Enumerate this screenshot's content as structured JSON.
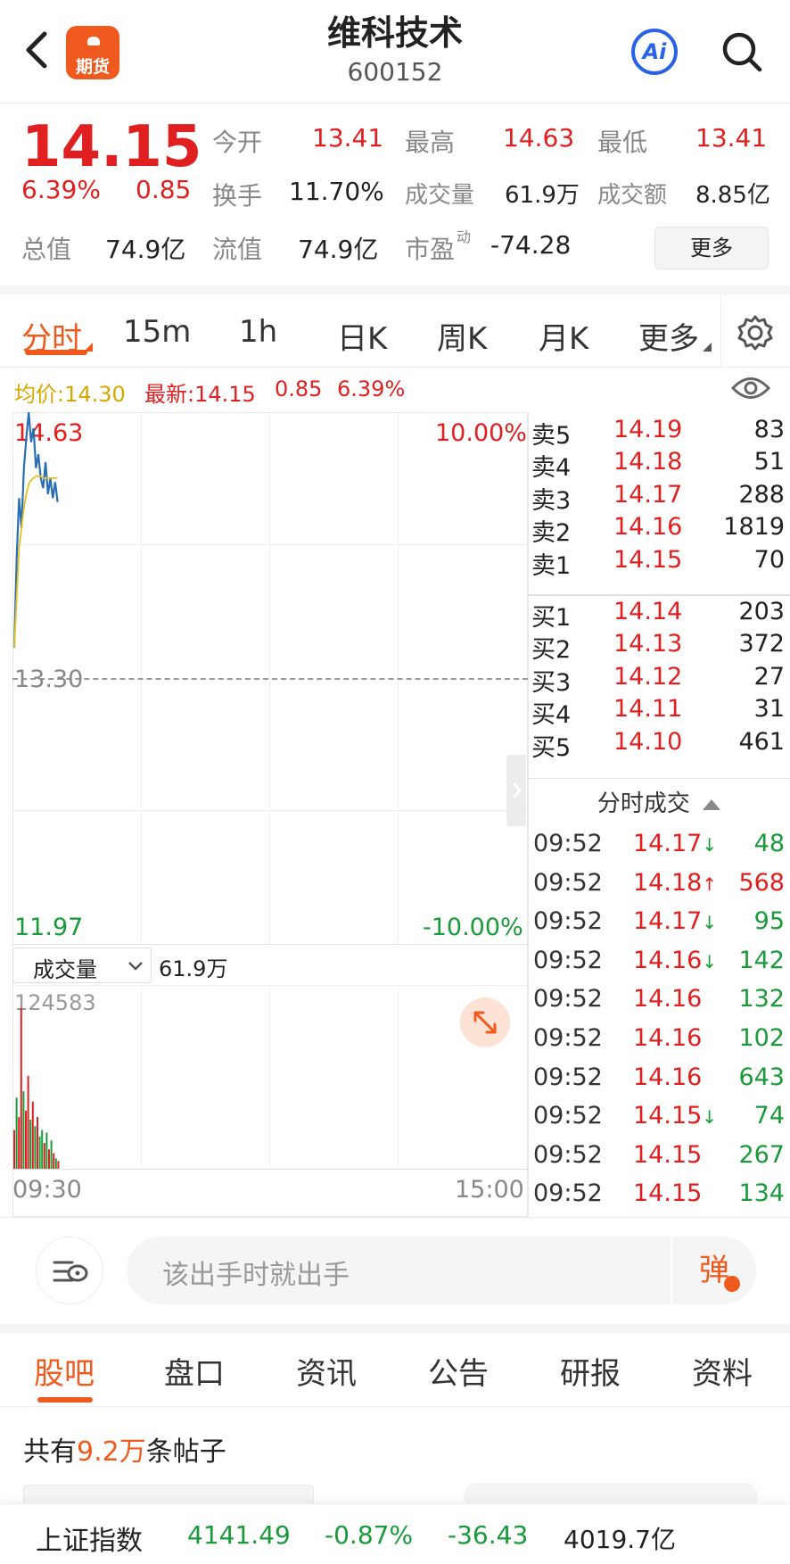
{
  "header": {
    "back_icon": "chevron-left-icon",
    "futures_badge": "期货",
    "title": "维科技术",
    "code": "600152",
    "ai_label": "Ai",
    "search_icon": "search-icon"
  },
  "quote": {
    "price": "14.15",
    "change_pct": "6.39%",
    "change": "0.85",
    "open_label": "今开",
    "open": "13.41",
    "high_label": "最高",
    "high": "14.63",
    "low_label": "最低",
    "low": "13.41",
    "turnover_label": "换手",
    "turnover": "11.70%",
    "volume_label": "成交量",
    "volume": "61.9万",
    "amount_label": "成交额",
    "amount": "8.85亿",
    "mktcap_label": "总值",
    "mktcap": "74.9亿",
    "float_label": "流值",
    "float": "74.9亿",
    "pe_label": "市盈",
    "pe_sup": "动",
    "pe": "-74.28",
    "more_button": "更多"
  },
  "period_tabs": [
    "分时",
    "15m",
    "1h",
    "日K",
    "周K",
    "月K",
    "更多"
  ],
  "chart_info": {
    "avg_label": "均价:14.30",
    "latest_label": "最新:14.15",
    "latest_change": "0.85",
    "latest_pct": "6.39%"
  },
  "chart_data": {
    "type": "line",
    "y_top_label": "14.63",
    "y_mid_label": "13.30",
    "y_bottom_label": "11.97",
    "pct_top_label": "10.00%",
    "pct_bottom_label": "-10.00%",
    "x_start": "09:30",
    "x_end": "15:00",
    "ylim": [
      11.97,
      14.63
    ],
    "series": [
      {
        "name": "price",
        "values": [
          13.45,
          13.9,
          14.2,
          14.05,
          14.35,
          14.5,
          14.63,
          14.48,
          14.55,
          14.35,
          14.42,
          14.3,
          14.25,
          14.38,
          14.22,
          14.3,
          14.2,
          14.28,
          14.18
        ]
      },
      {
        "name": "avg",
        "values": [
          13.45,
          13.7,
          13.95,
          14.05,
          14.15,
          14.22,
          14.27,
          14.29,
          14.3,
          14.31,
          14.31,
          14.31,
          14.3,
          14.3,
          14.3,
          14.3,
          14.3,
          14.3,
          14.3
        ]
      }
    ],
    "volume": {
      "max_label": "124583",
      "values": [
        30000,
        55000,
        40000,
        124583,
        60000,
        45000,
        72000,
        38000,
        52000,
        33000,
        40000,
        25000,
        30000,
        20000,
        28000,
        15000,
        22000,
        12000,
        8000,
        6000
      ],
      "up": [
        1,
        0,
        1,
        1,
        0,
        1,
        1,
        0,
        1,
        0,
        1,
        0,
        0,
        1,
        0,
        1,
        0,
        1,
        0,
        1
      ]
    },
    "volume_selector": "成交量",
    "volume_total": "61.9万"
  },
  "orderbook": {
    "asks": [
      {
        "label": "卖5",
        "price": "14.19",
        "vol": "83"
      },
      {
        "label": "卖4",
        "price": "14.18",
        "vol": "51"
      },
      {
        "label": "卖3",
        "price": "14.17",
        "vol": "288"
      },
      {
        "label": "卖2",
        "price": "14.16",
        "vol": "1819"
      },
      {
        "label": "卖1",
        "price": "14.15",
        "vol": "70"
      }
    ],
    "bids": [
      {
        "label": "买1",
        "price": "14.14",
        "vol": "203"
      },
      {
        "label": "买2",
        "price": "14.13",
        "vol": "372"
      },
      {
        "label": "买3",
        "price": "14.12",
        "vol": "27"
      },
      {
        "label": "买4",
        "price": "14.11",
        "vol": "31"
      },
      {
        "label": "买5",
        "price": "14.10",
        "vol": "461"
      }
    ]
  },
  "ticks_header": "分时成交",
  "ticks": [
    {
      "time": "09:52",
      "price": "14.17",
      "arrow": "↓",
      "vol": "48",
      "dir": "down"
    },
    {
      "time": "09:52",
      "price": "14.18",
      "arrow": "↑",
      "vol": "568",
      "dir": "up"
    },
    {
      "time": "09:52",
      "price": "14.17",
      "arrow": "↓",
      "vol": "95",
      "dir": "down"
    },
    {
      "time": "09:52",
      "price": "14.16",
      "arrow": "↓",
      "vol": "142",
      "dir": "down"
    },
    {
      "time": "09:52",
      "price": "14.16",
      "arrow": "",
      "vol": "132",
      "dir": "down"
    },
    {
      "time": "09:52",
      "price": "14.16",
      "arrow": "",
      "vol": "102",
      "dir": "down"
    },
    {
      "time": "09:52",
      "price": "14.16",
      "arrow": "",
      "vol": "643",
      "dir": "down"
    },
    {
      "time": "09:52",
      "price": "14.15",
      "arrow": "↓",
      "vol": "74",
      "dir": "down"
    },
    {
      "time": "09:52",
      "price": "14.15",
      "arrow": "",
      "vol": "267",
      "dir": "down"
    },
    {
      "time": "09:52",
      "price": "14.15",
      "arrow": "",
      "vol": "134",
      "dir": "down"
    }
  ],
  "comment": {
    "placeholder": "该出手时就出手",
    "danmu_label": "弹"
  },
  "section_tabs": [
    "股吧",
    "盘口",
    "资讯",
    "公告",
    "研报",
    "资料"
  ],
  "posts": {
    "prefix": "共有",
    "count": "9.2万",
    "suffix": "条帖子"
  },
  "footer": {
    "index_name": "上证指数",
    "index_value": "4141.49",
    "index_pct": "-0.87%",
    "index_change": "-36.43",
    "index_amount": "4019.7亿"
  },
  "colors": {
    "up": "#e02020",
    "down": "#1a9a3a",
    "accent": "#f05a1e",
    "price_line": "#2a6fb5",
    "avg_line": "#e8c020"
  }
}
